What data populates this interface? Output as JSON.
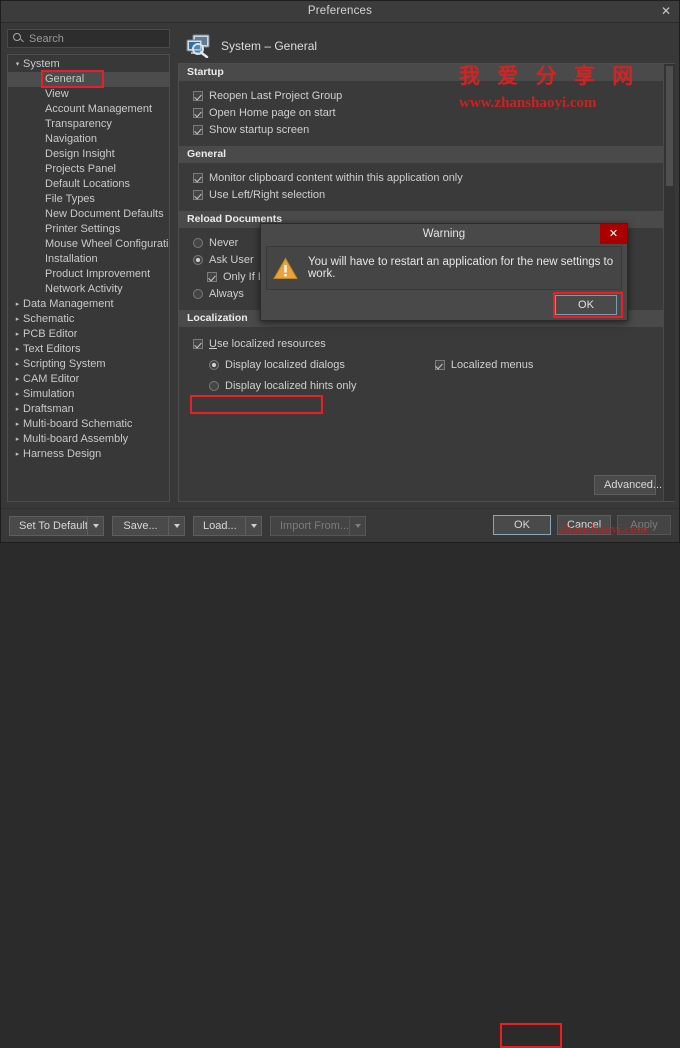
{
  "window": {
    "title": "Preferences",
    "close_label": "✕"
  },
  "search": {
    "placeholder": "Search",
    "icon": "search-icon"
  },
  "sidebar": {
    "items": [
      {
        "label": "System",
        "level": 1,
        "twisty": "▾",
        "selected": false
      },
      {
        "label": "General",
        "level": 2,
        "twisty": "",
        "selected": true
      },
      {
        "label": "View",
        "level": 2,
        "twisty": "",
        "selected": false
      },
      {
        "label": "Account Management",
        "level": 2,
        "twisty": "",
        "selected": false
      },
      {
        "label": "Transparency",
        "level": 2,
        "twisty": "",
        "selected": false
      },
      {
        "label": "Navigation",
        "level": 2,
        "twisty": "",
        "selected": false
      },
      {
        "label": "Design Insight",
        "level": 2,
        "twisty": "",
        "selected": false
      },
      {
        "label": "Projects Panel",
        "level": 2,
        "twisty": "",
        "selected": false
      },
      {
        "label": "Default Locations",
        "level": 2,
        "twisty": "",
        "selected": false
      },
      {
        "label": "File Types",
        "level": 2,
        "twisty": "",
        "selected": false
      },
      {
        "label": "New Document Defaults",
        "level": 2,
        "twisty": "",
        "selected": false
      },
      {
        "label": "Printer Settings",
        "level": 2,
        "twisty": "",
        "selected": false
      },
      {
        "label": "Mouse Wheel Configuration",
        "level": 2,
        "twisty": "",
        "selected": false
      },
      {
        "label": "Installation",
        "level": 2,
        "twisty": "",
        "selected": false
      },
      {
        "label": "Product Improvement",
        "level": 2,
        "twisty": "",
        "selected": false
      },
      {
        "label": "Network Activity",
        "level": 2,
        "twisty": "",
        "selected": false
      },
      {
        "label": "Data Management",
        "level": 1,
        "twisty": "▸",
        "selected": false
      },
      {
        "label": "Schematic",
        "level": 1,
        "twisty": "▸",
        "selected": false
      },
      {
        "label": "PCB Editor",
        "level": 1,
        "twisty": "▸",
        "selected": false
      },
      {
        "label": "Text Editors",
        "level": 1,
        "twisty": "▸",
        "selected": false
      },
      {
        "label": "Scripting System",
        "level": 1,
        "twisty": "▸",
        "selected": false
      },
      {
        "label": "CAM Editor",
        "level": 1,
        "twisty": "▸",
        "selected": false
      },
      {
        "label": "Simulation",
        "level": 1,
        "twisty": "▸",
        "selected": false
      },
      {
        "label": "Draftsman",
        "level": 1,
        "twisty": "▸",
        "selected": false
      },
      {
        "label": "Multi-board Schematic",
        "level": 1,
        "twisty": "▸",
        "selected": false
      },
      {
        "label": "Multi-board Assembly",
        "level": 1,
        "twisty": "▸",
        "selected": false
      },
      {
        "label": "Harness Design",
        "level": 1,
        "twisty": "▸",
        "selected": false
      }
    ]
  },
  "page": {
    "title": "System – General",
    "icon": "system-general-icon"
  },
  "sections": {
    "startup": {
      "title": "Startup",
      "options": [
        {
          "label": "Reopen Last Project Group",
          "checked": true
        },
        {
          "label": "Open Home page on start",
          "checked": true
        },
        {
          "label": "Show startup screen",
          "checked": true
        }
      ]
    },
    "general": {
      "title": "General",
      "options": [
        {
          "label": "Monitor clipboard content within this application only",
          "checked": true
        },
        {
          "label": "Use Left/Right selection",
          "checked": true
        }
      ]
    },
    "reload_documents": {
      "title": "Reload Documents",
      "options": [
        {
          "label": "Never",
          "selected": false
        },
        {
          "label": "Ask User",
          "selected": true
        },
        {
          "label": "Only If Docu",
          "checked": true,
          "child": true
        },
        {
          "label": "Always",
          "selected": false
        }
      ]
    },
    "localization": {
      "title": "Localization",
      "use_localized": {
        "label": "Use localized resources",
        "checked": true
      },
      "display_dialogs": {
        "label": "Display localized dialogs",
        "selected": true
      },
      "display_hints": {
        "label": "Display localized hints only",
        "selected": false
      },
      "localized_menus": {
        "label": "Localized menus",
        "checked": true
      }
    }
  },
  "advanced_button": {
    "label": "Advanced..."
  },
  "footer": {
    "set_to_defaults": "Set To Defaults",
    "save": "Save...",
    "load": "Load...",
    "import_from": "Import From...",
    "ok": "OK",
    "cancel": "Cancel",
    "apply": "Apply"
  },
  "dialog": {
    "title": "Warning",
    "close_label": "✕",
    "message": "You will have to restart an application for the new settings to work.",
    "ok": "OK",
    "icon": "warning-triangle-icon"
  },
  "watermark": {
    "chinese": "我 爱 分 享 网",
    "url": "www.zhanshaoyi.com",
    "footer_url": "zhanshaoyi.com"
  },
  "colors": {
    "accent_red": "#ee1c25",
    "dialog_close_red": "#a80000",
    "window_bg": "#383838",
    "section_head": "#4a4a4a",
    "warning_orange": "#e8a33d"
  }
}
